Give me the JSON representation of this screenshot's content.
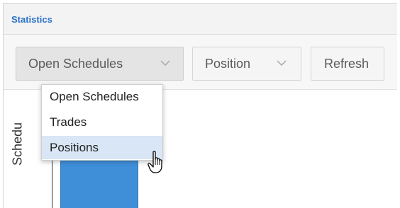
{
  "panel": {
    "title": "Statistics"
  },
  "toolbar": {
    "view_select": {
      "value": "Open Schedules"
    },
    "group_select": {
      "value": "Position"
    },
    "refresh_label": "Refresh"
  },
  "view_menu": {
    "options": [
      "Open Schedules",
      "Trades",
      "Positions"
    ],
    "hovered": "Positions"
  },
  "chart_data": {
    "type": "bar",
    "ylabel": "Schedu",
    "categories": [],
    "values": [],
    "colors": {
      "bar": "#3f8fd8"
    }
  },
  "colors": {
    "title": "#2a72c9",
    "menu_hover": "#d8e6f5"
  }
}
